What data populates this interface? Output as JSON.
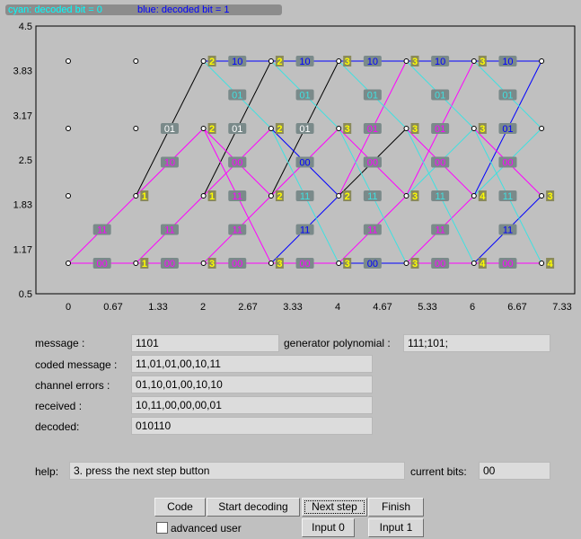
{
  "legend": {
    "cyan": "cyan: decoded bit = 0",
    "blue": "blue: decoded bit = 1"
  },
  "trellis": {
    "x_ticks": [
      "0",
      "0.67",
      "1.33",
      "2",
      "2.67",
      "3.33",
      "4",
      "4.67",
      "5.33",
      "6",
      "6.67",
      "7.33"
    ],
    "y_ticks": [
      "4.5",
      "3.83",
      "3.17",
      "2.5",
      "1.83",
      "1.17",
      "0.5"
    ],
    "x_range": [
      0,
      7.33
    ],
    "y_range": [
      0.5,
      4.5
    ],
    "colors": {
      "frame": "#000000",
      "inactive": "#ff00ff",
      "survivor": "#000000",
      "zero": "#40e0e0",
      "one": "#0000ff",
      "label_bg": "#7a8a8a",
      "metric_bg": "#8a8a5a",
      "metric_text": "#ffff00"
    },
    "edges": [
      {
        "from": [
          0,
          1
        ],
        "to": [
          1,
          1
        ],
        "color": "inactive",
        "label": "00"
      },
      {
        "from": [
          0,
          1
        ],
        "to": [
          1,
          2
        ],
        "color": "inactive",
        "label": "11"
      },
      {
        "from": [
          1,
          1
        ],
        "to": [
          2,
          1
        ],
        "color": "inactive",
        "label": "00"
      },
      {
        "from": [
          1,
          1
        ],
        "to": [
          2,
          2
        ],
        "color": "inactive",
        "label": "11"
      },
      {
        "from": [
          1,
          2
        ],
        "to": [
          2,
          3
        ],
        "color": "inactive",
        "label": "10"
      },
      {
        "from": [
          1,
          2
        ],
        "to": [
          2,
          4
        ],
        "color": "survivor",
        "label": "01"
      },
      {
        "from": [
          2,
          1
        ],
        "to": [
          3,
          1
        ],
        "color": "inactive",
        "label": "00"
      },
      {
        "from": [
          2,
          1
        ],
        "to": [
          3,
          2
        ],
        "color": "inactive",
        "label": "11"
      },
      {
        "from": [
          2,
          2
        ],
        "to": [
          3,
          3
        ],
        "color": "inactive",
        "label": "10"
      },
      {
        "from": [
          2,
          2
        ],
        "to": [
          3,
          4
        ],
        "color": "survivor",
        "label": "01"
      },
      {
        "from": [
          2,
          3
        ],
        "to": [
          3,
          1
        ],
        "color": "inactive",
        "label": "11"
      },
      {
        "from": [
          2,
          3
        ],
        "to": [
          3,
          2
        ],
        "color": "inactive",
        "label": "00"
      },
      {
        "from": [
          2,
          4
        ],
        "to": [
          3,
          3
        ],
        "color": "zero",
        "label": "01"
      },
      {
        "from": [
          2,
          4
        ],
        "to": [
          3,
          4
        ],
        "color": "one",
        "label": "10"
      },
      {
        "from": [
          3,
          1
        ],
        "to": [
          4,
          1
        ],
        "color": "inactive",
        "label": "00"
      },
      {
        "from": [
          3,
          1
        ],
        "to": [
          4,
          2
        ],
        "color": "one",
        "label": "11"
      },
      {
        "from": [
          3,
          2
        ],
        "to": [
          4,
          3
        ],
        "color": "inactive",
        "label": "10"
      },
      {
        "from": [
          3,
          2
        ],
        "to": [
          4,
          4
        ],
        "color": "survivor",
        "label": "01"
      },
      {
        "from": [
          3,
          3
        ],
        "to": [
          4,
          1
        ],
        "color": "zero",
        "label": "11"
      },
      {
        "from": [
          3,
          3
        ],
        "to": [
          4,
          2
        ],
        "color": "one",
        "label": "00"
      },
      {
        "from": [
          3,
          4
        ],
        "to": [
          4,
          3
        ],
        "color": "zero",
        "label": "01"
      },
      {
        "from": [
          3,
          4
        ],
        "to": [
          4,
          4
        ],
        "color": "one",
        "label": "10"
      },
      {
        "from": [
          4,
          1
        ],
        "to": [
          5,
          1
        ],
        "color": "one",
        "label": "00"
      },
      {
        "from": [
          4,
          1
        ],
        "to": [
          5,
          2
        ],
        "color": "inactive",
        "label": "11"
      },
      {
        "from": [
          4,
          2
        ],
        "to": [
          5,
          3
        ],
        "color": "survivor",
        "label": "10"
      },
      {
        "from": [
          4,
          2
        ],
        "to": [
          5,
          4
        ],
        "color": "inactive",
        "label": "01"
      },
      {
        "from": [
          4,
          3
        ],
        "to": [
          5,
          1
        ],
        "color": "zero",
        "label": "11"
      },
      {
        "from": [
          4,
          3
        ],
        "to": [
          5,
          2
        ],
        "color": "inactive",
        "label": "00"
      },
      {
        "from": [
          4,
          4
        ],
        "to": [
          5,
          3
        ],
        "color": "zero",
        "label": "01"
      },
      {
        "from": [
          4,
          4
        ],
        "to": [
          5,
          4
        ],
        "color": "one",
        "label": "10"
      },
      {
        "from": [
          5,
          1
        ],
        "to": [
          6,
          1
        ],
        "color": "inactive",
        "label": "00"
      },
      {
        "from": [
          5,
          1
        ],
        "to": [
          6,
          2
        ],
        "color": "inactive",
        "label": "11"
      },
      {
        "from": [
          5,
          2
        ],
        "to": [
          6,
          3
        ],
        "color": "zero",
        "label": "10"
      },
      {
        "from": [
          5,
          2
        ],
        "to": [
          6,
          4
        ],
        "color": "inactive",
        "label": "01"
      },
      {
        "from": [
          5,
          3
        ],
        "to": [
          6,
          1
        ],
        "color": "zero",
        "label": "11"
      },
      {
        "from": [
          5,
          3
        ],
        "to": [
          6,
          2
        ],
        "color": "inactive",
        "label": "00"
      },
      {
        "from": [
          5,
          4
        ],
        "to": [
          6,
          3
        ],
        "color": "zero",
        "label": "01"
      },
      {
        "from": [
          5,
          4
        ],
        "to": [
          6,
          4
        ],
        "color": "one",
        "label": "10"
      },
      {
        "from": [
          6,
          1
        ],
        "to": [
          7,
          1
        ],
        "color": "inactive",
        "label": "00"
      },
      {
        "from": [
          6,
          1
        ],
        "to": [
          7,
          2
        ],
        "color": "one",
        "label": "11"
      },
      {
        "from": [
          6,
          2
        ],
        "to": [
          7,
          3
        ],
        "color": "zero",
        "label": "10"
      },
      {
        "from": [
          6,
          2
        ],
        "to": [
          7,
          4
        ],
        "color": "one",
        "label": "01"
      },
      {
        "from": [
          6,
          3
        ],
        "to": [
          7,
          1
        ],
        "color": "zero",
        "label": "11"
      },
      {
        "from": [
          6,
          3
        ],
        "to": [
          7,
          2
        ],
        "color": "inactive",
        "label": "00"
      },
      {
        "from": [
          6,
          4
        ],
        "to": [
          7,
          3
        ],
        "color": "zero",
        "label": "01"
      },
      {
        "from": [
          6,
          4
        ],
        "to": [
          7,
          4
        ],
        "color": "one",
        "label": "10"
      }
    ],
    "metrics": [
      {
        "t": 1,
        "s": 1,
        "v": "1"
      },
      {
        "t": 1,
        "s": 2,
        "v": "1"
      },
      {
        "t": 2,
        "s": 1,
        "v": "3"
      },
      {
        "t": 2,
        "s": 2,
        "v": "1"
      },
      {
        "t": 2,
        "s": 3,
        "v": "2"
      },
      {
        "t": 2,
        "s": 4,
        "v": "2"
      },
      {
        "t": 3,
        "s": 1,
        "v": "3"
      },
      {
        "t": 3,
        "s": 2,
        "v": "2"
      },
      {
        "t": 3,
        "s": 3,
        "v": "2"
      },
      {
        "t": 3,
        "s": 4,
        "v": "2"
      },
      {
        "t": 4,
        "s": 1,
        "v": "3"
      },
      {
        "t": 4,
        "s": 2,
        "v": "2"
      },
      {
        "t": 4,
        "s": 3,
        "v": "3"
      },
      {
        "t": 4,
        "s": 4,
        "v": "3"
      },
      {
        "t": 5,
        "s": 1,
        "v": "3"
      },
      {
        "t": 5,
        "s": 2,
        "v": "3"
      },
      {
        "t": 5,
        "s": 3,
        "v": "3"
      },
      {
        "t": 5,
        "s": 4,
        "v": "3"
      },
      {
        "t": 6,
        "s": 1,
        "v": "4"
      },
      {
        "t": 6,
        "s": 2,
        "v": "4"
      },
      {
        "t": 6,
        "s": 3,
        "v": "3"
      },
      {
        "t": 6,
        "s": 4,
        "v": "3"
      },
      {
        "t": 7,
        "s": 1,
        "v": "4"
      },
      {
        "t": 7,
        "s": 2,
        "v": "3"
      }
    ]
  },
  "form": {
    "message_label": "message :",
    "message_value": "1101",
    "generator_label": "generator polynomial :",
    "generator_value": "111;101;",
    "coded_label": "coded message :",
    "coded_value": "11,01,01,00,10,11",
    "errors_label": "channel errors :",
    "errors_value": "01,10,01,00,10,10",
    "received_label": "received :",
    "received_value": "10,11,00,00,00,01",
    "decoded_label": "decoded:",
    "decoded_value": "010110",
    "help_label": "help:",
    "help_value": "3. press the next step button",
    "current_bits_label": "current bits:",
    "current_bits_value": "00"
  },
  "buttons": {
    "code": "Code",
    "start_decoding": "Start decoding",
    "next_step": "Next step",
    "finish": "Finish",
    "input0": "Input 0",
    "input1": "Input 1"
  },
  "advanced_user": {
    "label": "advanced user",
    "checked": false
  }
}
